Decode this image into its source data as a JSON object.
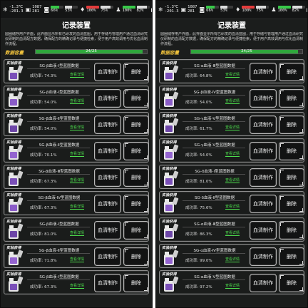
{
  "panels": [
    {
      "status": {
        "temp": "-1.3℃",
        "coords": "-201.3",
        "counter": "1087",
        "counter2": "281",
        "pct1": "66%",
        "pct2": "53%",
        "pct3": "100%",
        "pct4": "75%",
        "pct5": "100%",
        "pct6": "82%",
        "bar1": 0.66,
        "bar2": 0.53,
        "bar3": 1.0,
        "bar4": 0.75,
        "bar5": 1.0,
        "bar6": 0.82
      },
      "title": "记录装置",
      "description": "圆圈储存用户界面，此界面显示所有已研发的血清蓝图，用于存储与管理用户通过血清研究仪研制的血清配方数据，确保配方的精确记录与便捷检索，便于用户高效调用与优化血清制作流程。",
      "capacity_label": "数据容量",
      "capacity_text": "24/25",
      "capacity_fraction": 0.96,
      "records": [
        {
          "tag": "实验获得",
          "name": "SG-β血液-Ⅰ型蓝图数据",
          "rate_label": "成功率:",
          "rate": "74.3%",
          "detail": "查看详情",
          "make": "血清制作",
          "delete": "删除",
          "color": "#7a4fb8"
        },
        {
          "tag": "实验获得",
          "name": "SG-β血液-Ⅰ型蓝图数据",
          "rate_label": "成功率:",
          "rate": "54.0%",
          "detail": "查看详情",
          "make": "血清制作",
          "delete": "删除",
          "color": "#8a5cc8"
        },
        {
          "tag": "实验获得",
          "name": "SG-β血液-Ⅱ型蓝图数据",
          "rate_label": "成功率:",
          "rate": "54.0%",
          "detail": "查看详情",
          "make": "血清制作",
          "delete": "删除",
          "color": "#6d46a8"
        },
        {
          "tag": "实验获得",
          "name": "SG-β血液-Ⅱ型蓝图数据",
          "rate_label": "成功率:",
          "rate": "70.1%",
          "detail": "查看详情",
          "make": "血清制作",
          "delete": "删除",
          "color": "#9464d0"
        },
        {
          "tag": "实验获得",
          "name": "SG-β血液-Ⅲ型蓝图数据",
          "rate_label": "成功率:",
          "rate": "67.3%",
          "detail": "查看详情",
          "make": "血清制作",
          "delete": "删除",
          "color": "#7a4fb8"
        },
        {
          "tag": "实验获得",
          "name": "SG-β血液-Ⅳ型蓝图数据",
          "rate_label": "成功率:",
          "rate": "67.3%",
          "detail": "查看详情",
          "make": "血清制作",
          "delete": "删除",
          "color": "#8a5cc8"
        },
        {
          "tag": "实验获得",
          "name": "SG-β血液-Ⅰ型蓝图数据",
          "rate_label": "成功率:",
          "rate": "81.0%",
          "detail": "查看详情",
          "make": "血清制作",
          "delete": "删除",
          "color": "#6d46a8"
        },
        {
          "tag": "实验获得",
          "name": "SG-β血液-Ⅱ型蓝图数据",
          "rate_label": "成功率:",
          "rate": "71.8%",
          "detail": "查看详情",
          "make": "血清制作",
          "delete": "删除",
          "color": "#9464d0"
        },
        {
          "tag": "实验获得",
          "name": "SG-β血液-Ⅰ型蓝图数据",
          "rate_label": "成功率:",
          "rate": "67.3%",
          "detail": "查看详情",
          "make": "血清制作",
          "delete": "删除",
          "color": "#7a4fb8"
        }
      ]
    },
    {
      "status": {
        "temp": "-1.3℃",
        "coords": "-201.3",
        "counter": "1087",
        "counter2": "281",
        "pct1": "66%",
        "pct2": "53%",
        "pct3": "100%",
        "pct4": "75%",
        "pct5": "100%",
        "pct6": "82%",
        "bar1": 0.66,
        "bar2": 0.53,
        "bar3": 1.0,
        "bar4": 0.75,
        "bar5": 1.0,
        "bar6": 0.82
      },
      "title": "记录装置",
      "description": "圆圈储存用户界面，此界面显示所有已研发的血清蓝图，用于存储与管理用户通过血清研究仪研制的血清配方数据，确保配方的精确记录与便捷检索，便于用户高效调用与优化血清制作流程。",
      "capacity_label": "数据容量",
      "capacity_text": "24/25",
      "capacity_fraction": 0.96,
      "records": [
        {
          "tag": "实验获得",
          "name": "SG-α血液-Ⅲ型蓝图数据",
          "rate_label": "成功率:",
          "rate": "64.8%",
          "detail": "查看详情",
          "make": "血清制作",
          "delete": "删除",
          "color": "#7a4fb8"
        },
        {
          "tag": "实验获得",
          "name": "SG-β血液-Ⅳ型蓝图数据",
          "rate_label": "成功率:",
          "rate": "54.0%",
          "detail": "查看详情",
          "make": "血清制作",
          "delete": "删除",
          "color": "#8a5cc8"
        },
        {
          "tag": "实验获得",
          "name": "SG-γ血液-Ⅴ型蓝图数据",
          "rate_label": "成功率:",
          "rate": "61.7%",
          "detail": "查看详情",
          "make": "血清制作",
          "delete": "删除",
          "color": "#6d46a8"
        },
        {
          "tag": "实验获得",
          "name": "SG-γ血液-Ⅴ型蓝图数据",
          "rate_label": "成功率:",
          "rate": "54.0%",
          "detail": "查看详情",
          "make": "血清制作",
          "delete": "删除",
          "color": "#9464d0"
        },
        {
          "tag": "实验获得",
          "name": "SG-δ血液-Ⅰ型蓝图数据",
          "rate_label": "成功率:",
          "rate": "81.0%",
          "detail": "查看详情",
          "make": "血清制作",
          "delete": "删除",
          "color": "#7a4fb8"
        },
        {
          "tag": "实验获得",
          "name": "SG-δ血液-Ⅱ型蓝图数据",
          "rate_label": "成功率:",
          "rate": "75.6%",
          "detail": "查看详情",
          "make": "血清制作",
          "delete": "删除",
          "color": "#8a5cc8"
        },
        {
          "tag": "实验获得",
          "name": "SG-α血液-Ⅲ型蓝图数据",
          "rate_label": "成功率:",
          "rate": "86.3%",
          "detail": "查看详情",
          "make": "血清制作",
          "delete": "删除",
          "color": "#6d46a8"
        },
        {
          "tag": "实验获得",
          "name": "SG-α血液-Ⅳ型蓝图数据",
          "rate_label": "成功率:",
          "rate": "99.0%",
          "detail": "查看详情",
          "make": "血清制作",
          "delete": "删除",
          "color": "#9464d0"
        },
        {
          "tag": "实验获得",
          "name": "SG-α血液-Ⅴ型蓝图数据",
          "rate_label": "成功率:",
          "rate": "97.2%",
          "detail": "查看详情",
          "make": "血清制作",
          "delete": "删除",
          "color": "#7a4fb8"
        }
      ]
    }
  ]
}
